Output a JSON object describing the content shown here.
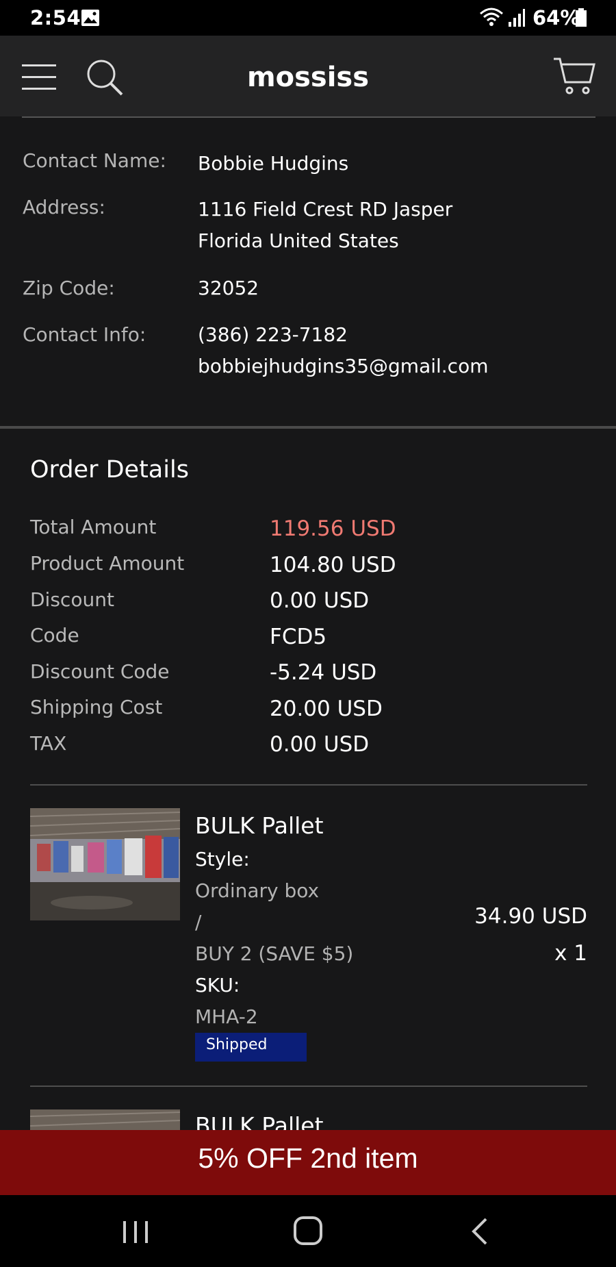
{
  "status_bar": {
    "time": "2:54",
    "battery": "64%",
    "icons": [
      "image-icon",
      "wifi-icon",
      "signal-icon",
      "battery-icon"
    ]
  },
  "header": {
    "brand": "mossiss",
    "icons": [
      "menu-icon",
      "search-icon",
      "cart-icon"
    ]
  },
  "contact": {
    "name_label": "Contact Name:",
    "name": "Bobbie Hudgins",
    "address_label": "Address:",
    "address_line1": "1116 Field Crest RD Jasper",
    "address_line2": "Florida United States",
    "zip_label": "Zip Code:",
    "zip": "32052",
    "info_label": "Contact Info:",
    "phone": "(386) 223-7182",
    "email": "bobbiejhudgins35@gmail.com"
  },
  "order_details": {
    "title": "Order Details",
    "rows": [
      {
        "label": "Total Amount",
        "value": "119.56 USD"
      },
      {
        "label": "Product Amount",
        "value": "104.80 USD"
      },
      {
        "label": "Discount",
        "value": "0.00 USD"
      },
      {
        "label": "Code",
        "value": "FCD5"
      },
      {
        "label": "Discount Code",
        "value": "-5.24 USD"
      },
      {
        "label": "Shipping Cost",
        "value": "20.00 USD"
      },
      {
        "label": "TAX",
        "value": "0.00 USD"
      }
    ],
    "accent_color": "#f07a72"
  },
  "items": [
    {
      "name": "BULK Pallet",
      "style_label": "Style:",
      "style_value_1": "Ordinary box",
      "style_value_2": "/",
      "style_value_3": "BUY 2  (SAVE $5)",
      "sku_label": "SKU:",
      "sku": "MHA-2",
      "status": "Shipped",
      "price": "34.90 USD",
      "qty": "x 1"
    },
    {
      "name": "BULK Pallet"
    }
  ],
  "promo": {
    "text": "5% OFF 2nd item",
    "color": "#7e0b0b"
  },
  "nav": {
    "icons": [
      "recent-apps-icon",
      "home-icon",
      "back-icon"
    ]
  }
}
